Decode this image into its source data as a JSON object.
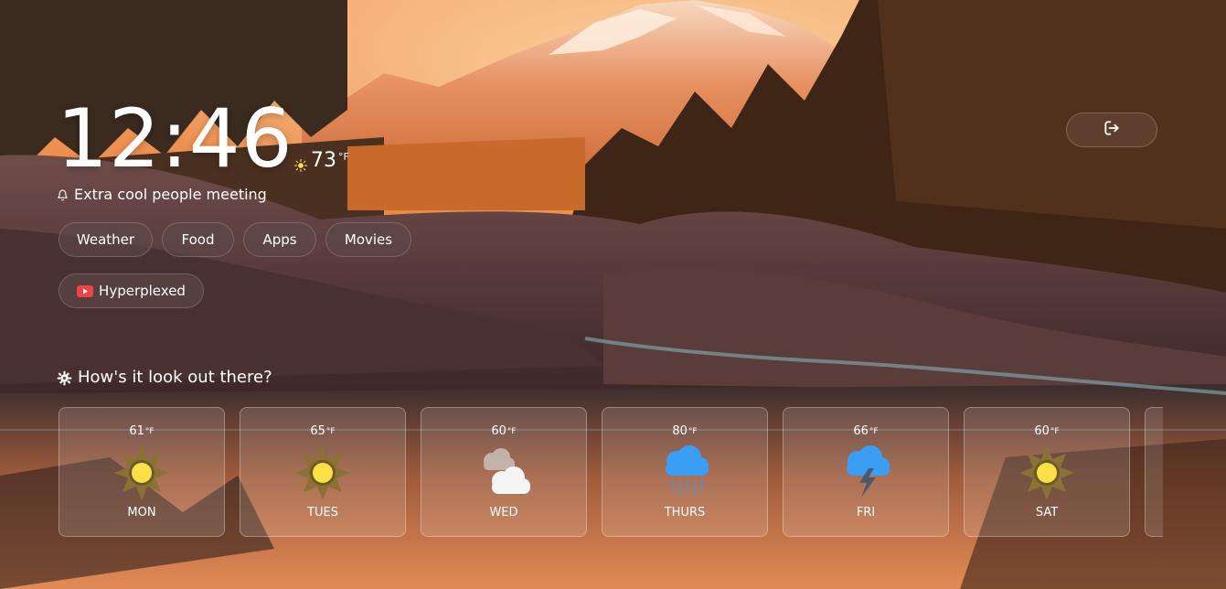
{
  "clock": {
    "time": "12:46"
  },
  "current_weather": {
    "icon": "sun-icon",
    "temp": "73",
    "unit": "°F"
  },
  "reminder": {
    "icon": "bell-icon",
    "text": "Extra cool people meeting"
  },
  "nav": {
    "pills": [
      {
        "label": "Weather"
      },
      {
        "label": "Food"
      },
      {
        "label": "Apps"
      },
      {
        "label": "Movies"
      }
    ],
    "bookmark": {
      "icon": "youtube-icon",
      "label": "Hyperplexed"
    }
  },
  "logout": {
    "icon": "logout-icon"
  },
  "forecast": {
    "title": "How's it look out there?",
    "title_icon": "gear-icon",
    "unit": "°F",
    "days": [
      {
        "temp": "61",
        "day": "MON",
        "icon": "sun-icon"
      },
      {
        "temp": "65",
        "day": "TUES",
        "icon": "sun-icon"
      },
      {
        "temp": "60",
        "day": "WED",
        "icon": "cloud-icon"
      },
      {
        "temp": "80",
        "day": "THURS",
        "icon": "rain-cloud-icon"
      },
      {
        "temp": "66",
        "day": "FRI",
        "icon": "storm-cloud-icon"
      },
      {
        "temp": "60",
        "day": "SAT",
        "icon": "sun-icon"
      }
    ]
  },
  "colors": {
    "sun_ray": "#8a7235",
    "sun_core": "#fde047",
    "rain_cloud": "#3b9ef5",
    "cloud_white": "#f5f5f5",
    "youtube_red": "#ef4444"
  }
}
